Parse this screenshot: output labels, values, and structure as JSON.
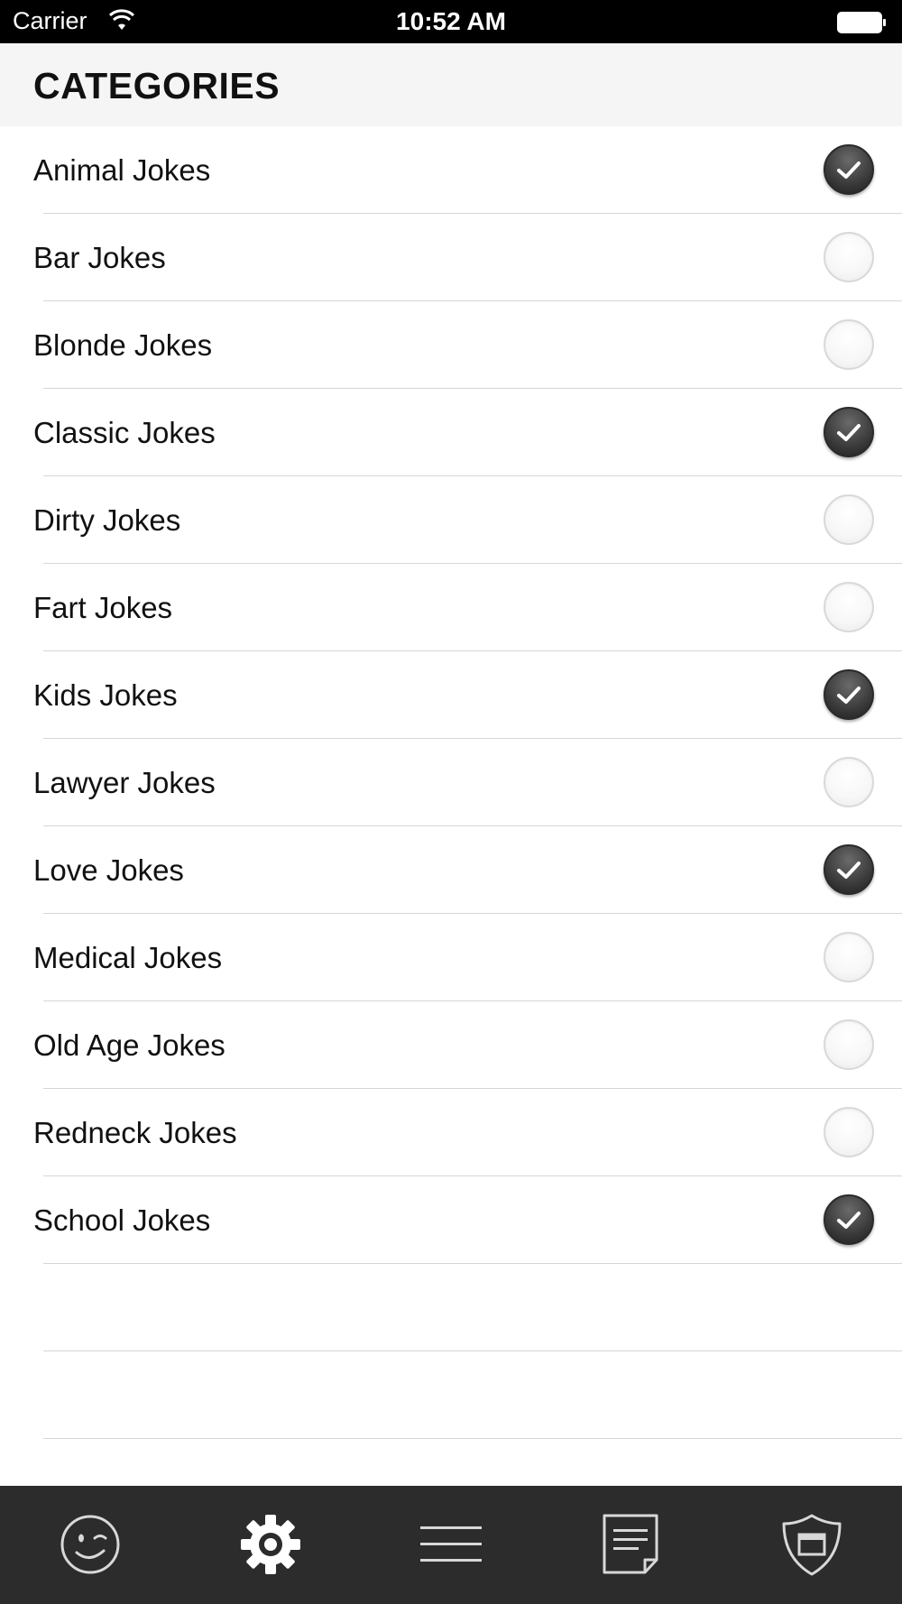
{
  "status_bar": {
    "carrier": "Carrier",
    "time": "10:52 AM"
  },
  "header": {
    "title": "CATEGORIES"
  },
  "categories": [
    {
      "label": "Animal Jokes",
      "checked": true
    },
    {
      "label": "Bar Jokes",
      "checked": false
    },
    {
      "label": "Blonde Jokes",
      "checked": false
    },
    {
      "label": "Classic Jokes",
      "checked": true
    },
    {
      "label": "Dirty Jokes",
      "checked": false
    },
    {
      "label": "Fart Jokes",
      "checked": false
    },
    {
      "label": "Kids Jokes",
      "checked": true
    },
    {
      "label": "Lawyer Jokes",
      "checked": false
    },
    {
      "label": "Love Jokes",
      "checked": true
    },
    {
      "label": "Medical Jokes",
      "checked": false
    },
    {
      "label": "Old Age Jokes",
      "checked": false
    },
    {
      "label": "Redneck Jokes",
      "checked": false
    },
    {
      "label": "School Jokes",
      "checked": true
    }
  ],
  "tab_bar": {
    "tabs": [
      {
        "icon": "wink-face-icon",
        "selected": false
      },
      {
        "icon": "gear-icon",
        "selected": true
      },
      {
        "icon": "menu-lines-icon",
        "selected": false
      },
      {
        "icon": "note-icon",
        "selected": false
      },
      {
        "icon": "shield-icon",
        "selected": false
      }
    ]
  },
  "colors": {
    "status_bar_bg": "#000000",
    "header_bg": "#f5f5f5",
    "tab_bar_bg": "#2c2c2c",
    "icon_inactive": "#d8d8d8",
    "icon_active": "#ffffff"
  }
}
